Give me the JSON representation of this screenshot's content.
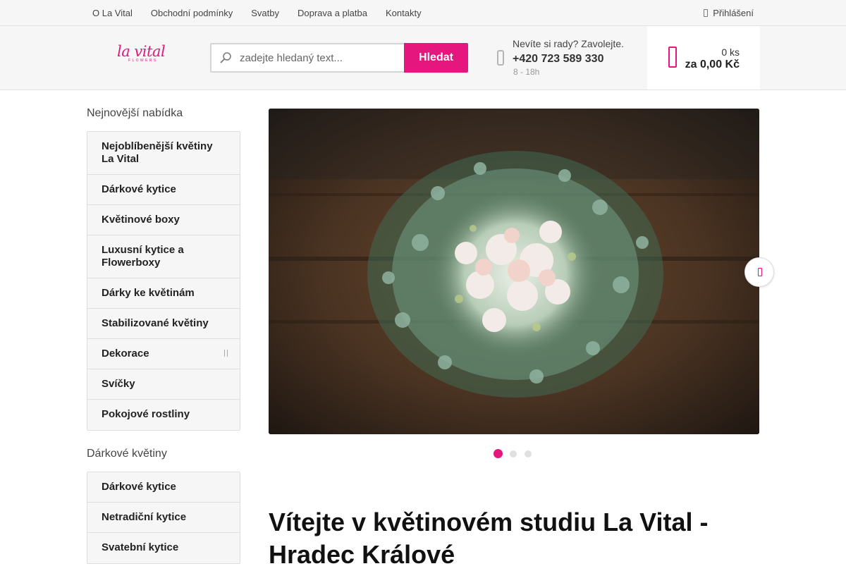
{
  "topbar": {
    "links": [
      "O La Vital",
      "Obchodní podmínky",
      "Svatby",
      "Doprava a platba",
      "Kontakty"
    ],
    "login": "Přihlášení"
  },
  "header": {
    "logo_text": "la vital",
    "logo_sub": "FLOWERS",
    "search_placeholder": "zadejte hledaný text...",
    "search_button": "Hledat",
    "phone_question": "Nevíte si rady? Zavolejte.",
    "phone_number": "+420 723 589 330",
    "phone_hours": "8 - 18h",
    "cart_qty": "0 ks",
    "cart_price": "za 0,00 Kč"
  },
  "sidebar": {
    "section1_title": "Nejnovější nabídka",
    "section1_items": [
      "Nejoblíbenější květiny La Vital",
      "Dárkové kytice",
      "Květinové boxy",
      "Luxusní kytice a Flowerboxy",
      "Dárky ke květinám",
      "Stabilizované květiny",
      "Dekorace",
      "Svíčky",
      "Pokojové rostliny"
    ],
    "section2_title": "Dárkové květiny",
    "section2_items": [
      "Dárkové kytice",
      "Netradiční kytice",
      "Svatební kytice"
    ]
  },
  "slider": {
    "slide_count": 3,
    "active_slide": 1
  },
  "main": {
    "heading": "Vítejte v květinovém studiu La Vital - Hradec Králové"
  },
  "colors": {
    "accent": "#e6167f"
  }
}
